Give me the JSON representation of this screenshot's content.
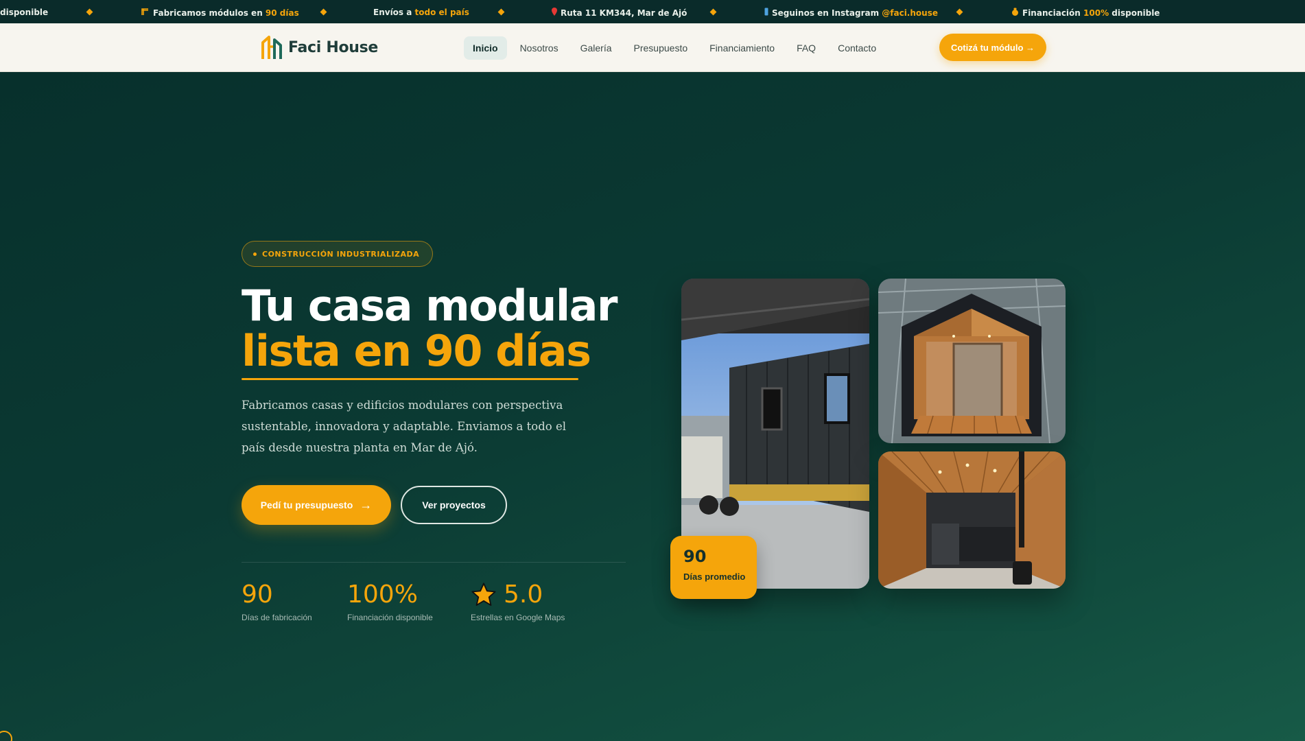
{
  "ticker": {
    "items": [
      {
        "text": "disponible"
      },
      {
        "icon": "crane-icon",
        "before": "Fabricamos módulos en ",
        "highlight": "90 días",
        "after": ""
      },
      {
        "before": "Envíos a ",
        "highlight": "todo el país",
        "after": ""
      },
      {
        "icon": "pin-icon",
        "before": "Ruta 11 KM344, Mar de Ajó",
        "highlight": "",
        "after": ""
      },
      {
        "icon": "phone-icon",
        "before": "Seguinos en Instagram ",
        "highlight": "@faci.house",
        "after": ""
      },
      {
        "icon": "money-bag-icon",
        "before": "Financiación ",
        "highlight": "100%",
        "after": " disponible"
      }
    ]
  },
  "header": {
    "brand": "Faci House",
    "nav": [
      "Inicio",
      "Nosotros",
      "Galería",
      "Presupuesto",
      "Financiamiento",
      "FAQ",
      "Contacto"
    ],
    "active_nav": "Inicio",
    "cta_label": "Cotizá tu módulo →"
  },
  "hero": {
    "badge": "CONSTRUCCIÓN INDUSTRIALIZADA",
    "title_line1": "Tu casa modular",
    "title_line2": "lista en 90 días",
    "description": "Fabricamos casas y edificios modulares con perspectiva sustentable, innovadora y adaptable. Enviamos a todo el país desde nuestra planta en Mar de Ajó.",
    "primary_button": "Pedí tu presupuesto",
    "secondary_button": "Ver proyectos",
    "stats": [
      {
        "value": "90",
        "label": "Días de fabricación"
      },
      {
        "value": "100%",
        "label": "Financiación disponible"
      },
      {
        "value": "5.0",
        "label": "Estrellas en Google Maps",
        "icon": "star-icon"
      }
    ],
    "days_card": {
      "value": "90",
      "label": "Días promedio"
    }
  },
  "colors": {
    "accent": "#f5a50b",
    "dark_green": "#0b3a33",
    "header_bg": "#f7f5ef"
  }
}
